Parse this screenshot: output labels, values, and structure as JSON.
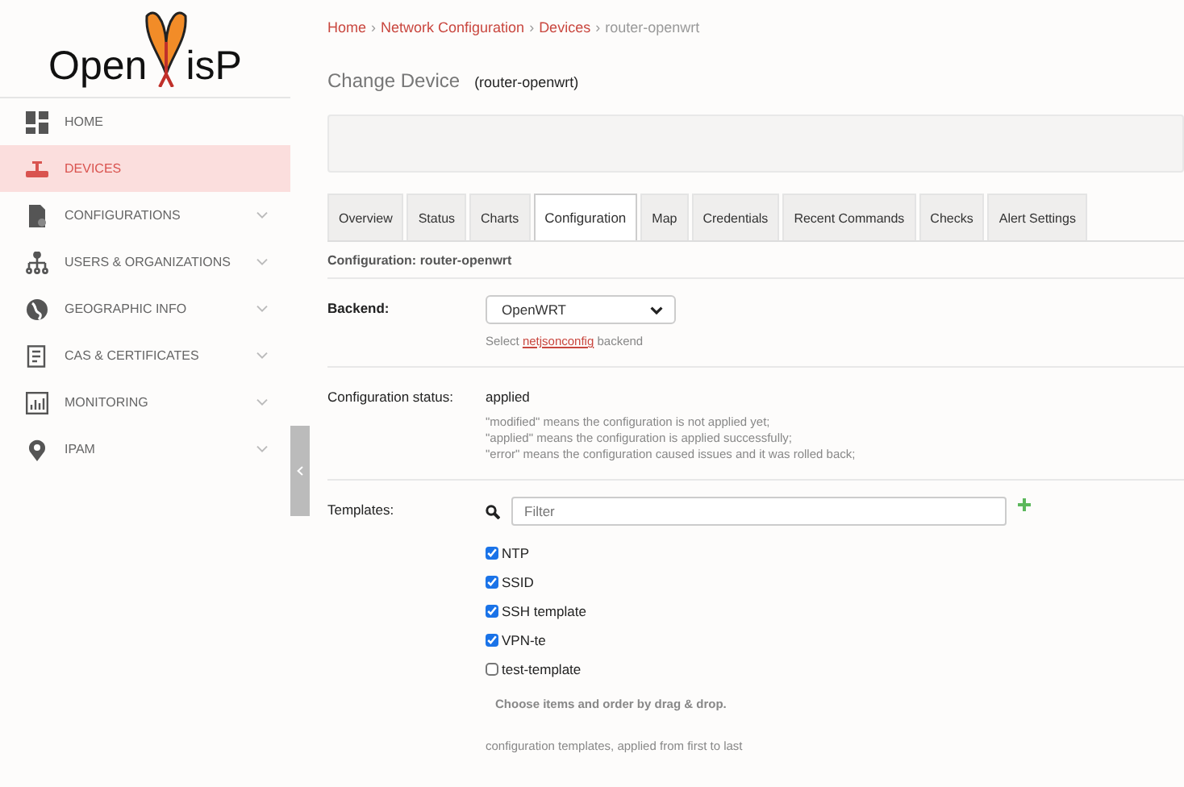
{
  "logo": {
    "left": "Open",
    "right": "isP"
  },
  "sidebar": {
    "items": [
      {
        "label": "HOME",
        "kind": "link",
        "selected": false
      },
      {
        "label": "DEVICES",
        "kind": "link",
        "selected": true
      },
      {
        "label": "CONFIGURATIONS",
        "kind": "group",
        "selected": false
      },
      {
        "label": "USERS & ORGANIZATIONS",
        "kind": "group",
        "selected": false
      },
      {
        "label": "GEOGRAPHIC INFO",
        "kind": "group",
        "selected": false
      },
      {
        "label": "CAS & CERTIFICATES",
        "kind": "group",
        "selected": false
      },
      {
        "label": "MONITORING",
        "kind": "group",
        "selected": false
      },
      {
        "label": "IPAM",
        "kind": "group",
        "selected": false
      }
    ]
  },
  "breadcrumb": [
    {
      "label": "Home",
      "kind": "link"
    },
    {
      "label": "›",
      "kind": "separator"
    },
    {
      "label": "Network Configuration",
      "kind": "link"
    },
    {
      "label": "›",
      "kind": "separator"
    },
    {
      "label": "Devices",
      "kind": "link"
    },
    {
      "label": "›",
      "kind": "separator"
    },
    {
      "label": "router-openwrt",
      "kind": "current"
    }
  ],
  "page_title": "Change Device",
  "page_subtitle": "(router-openwrt)",
  "tabs": [
    {
      "label": "Overview",
      "selected": false
    },
    {
      "label": "Status",
      "selected": false
    },
    {
      "label": "Charts",
      "selected": false
    },
    {
      "label": "Configuration",
      "selected": true
    },
    {
      "label": "Map",
      "selected": false
    },
    {
      "label": "Credentials",
      "selected": false
    },
    {
      "label": "Recent Commands",
      "selected": false
    },
    {
      "label": "Checks",
      "selected": false
    },
    {
      "label": "Alert Settings",
      "selected": false
    }
  ],
  "section_title": "Configuration: router-openwrt",
  "backend": {
    "label": "Backend:",
    "value": "OpenWRT",
    "help_before": "Select",
    "help_link": "netjsonconfig",
    "help_after": "backend"
  },
  "status": {
    "label": "Configuration status:",
    "value": "applied",
    "help": [
      "\"modified\" means the configuration is not applied yet;",
      "\"applied\" means the configuration is applied successfully;",
      "\"error\" means the configuration caused issues and it was rolled back;"
    ]
  },
  "templates": {
    "label": "Templates:",
    "placeholder": "Filter",
    "items": [
      {
        "label": "NTP",
        "checked": true
      },
      {
        "label": "SSID",
        "checked": true
      },
      {
        "label": "SSH template",
        "checked": true
      },
      {
        "label": "VPN-te",
        "checked": true
      },
      {
        "label": "test-template",
        "checked": false
      }
    ],
    "hint": "Choose items and order by drag & drop.",
    "help": "configuration templates, applied from first to last"
  }
}
